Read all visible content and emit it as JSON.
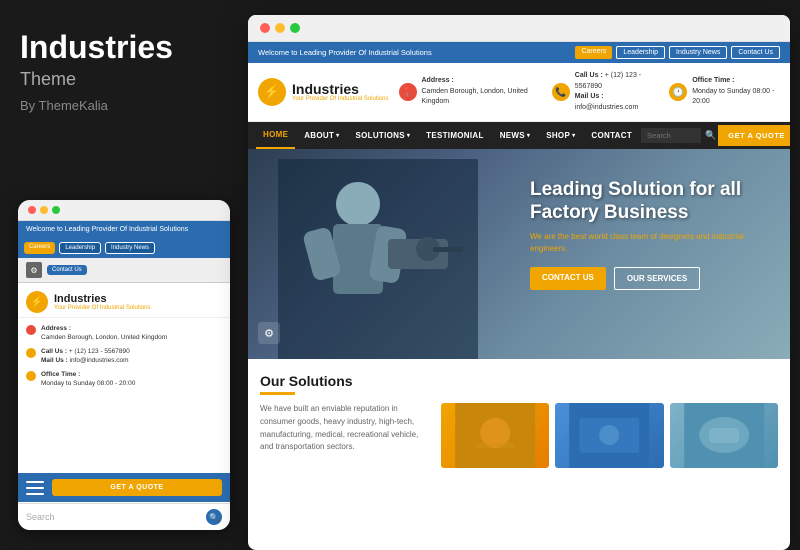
{
  "left": {
    "title": "Industries",
    "subtitle": "Theme",
    "by": "By ThemeKalia"
  },
  "mobile": {
    "topbar": "Welcome to Leading Provider Of Industrial Solutions",
    "pills": [
      "Careers",
      "Leadership",
      "Industry News"
    ],
    "contact_pill": "Contact Us",
    "logo_name": "Industries",
    "logo_tagline": "Your Provider Of Industrial Solutions",
    "address_label": "Address :",
    "address_value": "Camden Borough, London, United Kingdom",
    "call_label": "Call Us :",
    "call_value": "+ (12) 123 - 5567890",
    "mail_label": "Mail Us :",
    "mail_value": "info@industries.com",
    "office_label": "Office Time :",
    "office_value": "Monday to Sunday 08:00 - 20:00",
    "quote_btn": "GET A QUOTE",
    "search_placeholder": "Search"
  },
  "desktop": {
    "topbar_text": "Welcome to Leading Provider Of Industrial Solutions",
    "topbar_pills": [
      "Careers",
      "Leadership",
      "Industry News",
      "Contact Us"
    ],
    "logo_name": "Industries",
    "logo_tagline": "Your Provider Of Industrial Solutions",
    "address_label": "Address :",
    "address_value": "Camden Borough, London, United Kingdom",
    "call_label": "Call Us :",
    "call_value": "+ (12) 123 - 5567890",
    "mail_label": "Mail Us :",
    "mail_value": "info@industries.com",
    "office_label": "Office Time :",
    "office_value": "Monday to Sunday 08:00 - 20:00",
    "nav_items": [
      "HOME",
      "ABOUT",
      "SOLUTIONS",
      "TESTIMONIAL",
      "NEWS",
      "SHOP",
      "CONTACT"
    ],
    "search_placeholder": "Search",
    "quote_btn": "GET A QUOTE",
    "hero_title": "Leading Solution for all Factory Business",
    "hero_subtitle": "We are the best world class team of designers and industrial engineers.",
    "hero_btn1": "Contact Us",
    "hero_btn2": "Our Services",
    "solutions_title": "Our Solutions",
    "solutions_desc": "We have built an enviable reputation in consumer goods, heavy industry, high-tech, manufacturing, medical, recreational vehicle, and transportation sectors."
  }
}
